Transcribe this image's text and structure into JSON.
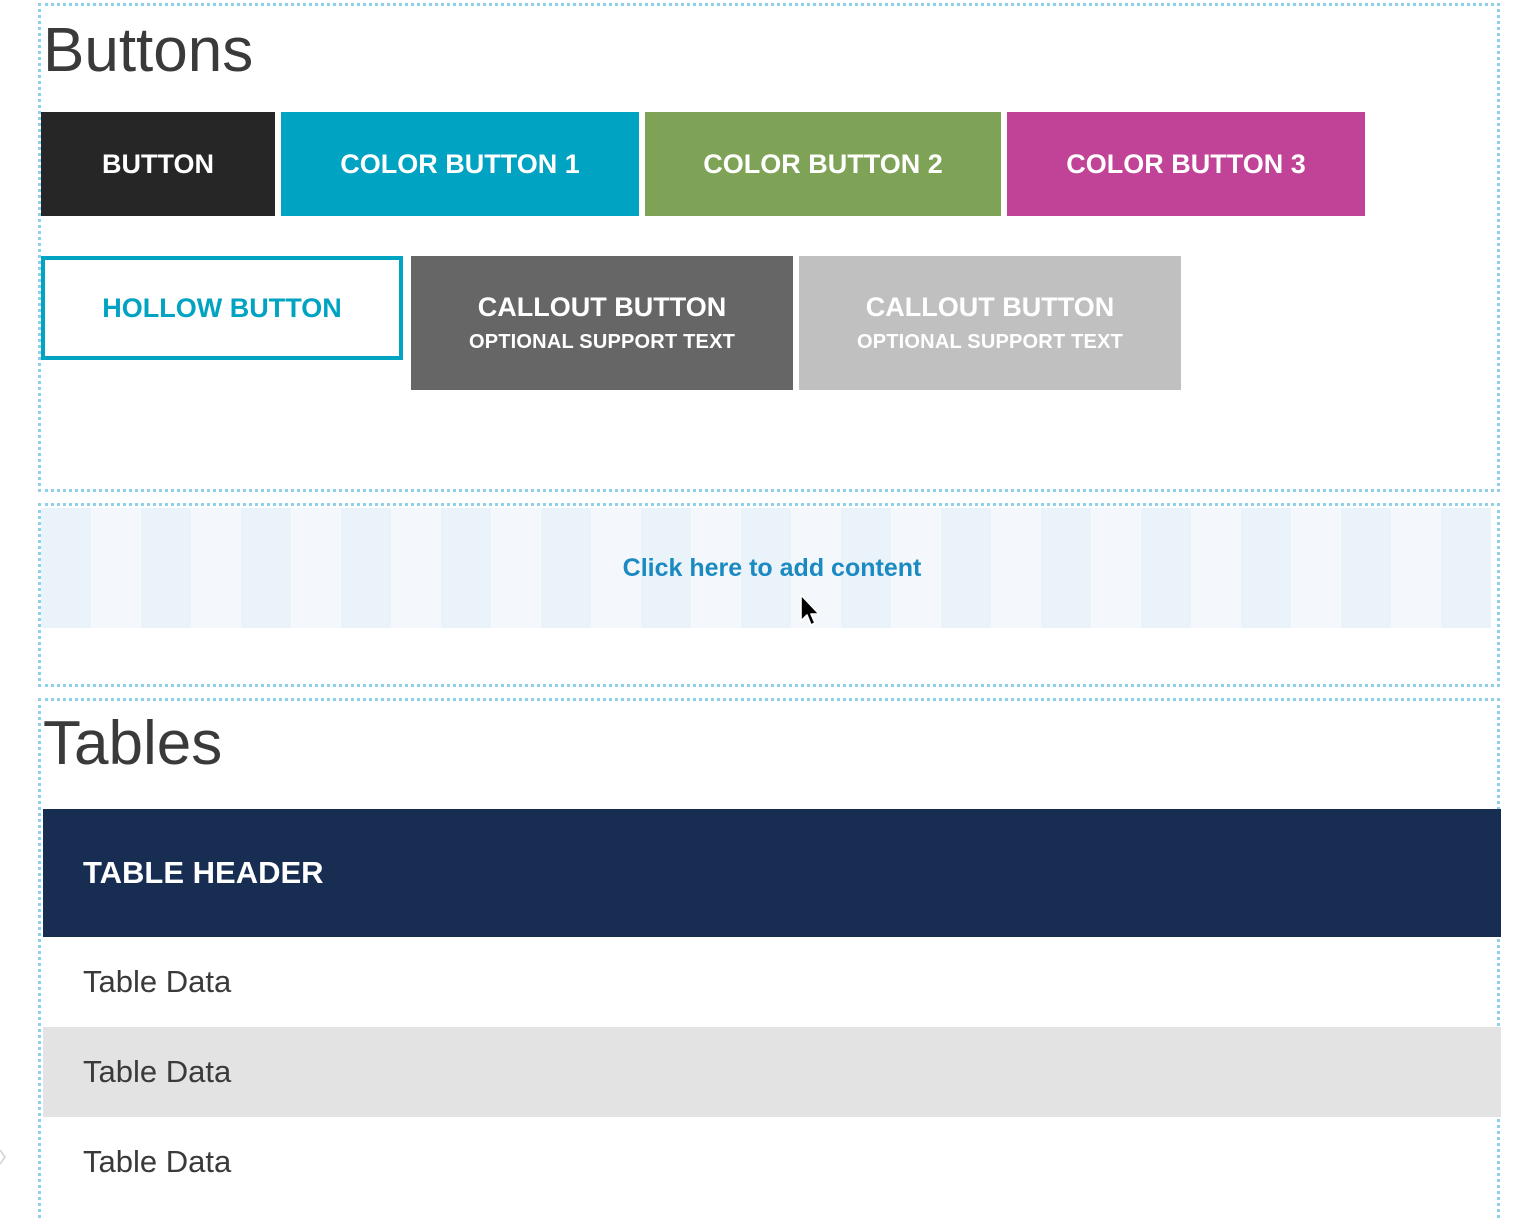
{
  "buttons_section": {
    "heading": "Buttons",
    "button": "BUTTON",
    "color_button_1": "COLOR BUTTON 1",
    "color_button_2": "COLOR BUTTON 2",
    "color_button_3": "COLOR BUTTON 3",
    "hollow_button": "HOLLOW BUTTON",
    "callout_dark": {
      "label": "CALLOUT BUTTON",
      "support": "OPTIONAL SUPPORT TEXT"
    },
    "callout_light": {
      "label": "CALLOUT BUTTON",
      "support": "OPTIONAL SUPPORT TEXT"
    }
  },
  "add_content": {
    "label": "Click here to add content"
  },
  "tables_section": {
    "heading": "Tables",
    "header": "TABLE HEADER",
    "rows": [
      "Table Data",
      "Table Data",
      "Table Data"
    ]
  },
  "colors": {
    "dark_button": "#262626",
    "color_1": "#00a3c1",
    "color_2": "#7ea356",
    "color_3": "#c04398",
    "callout_dark": "#666666",
    "callout_light": "#c0c0c0",
    "table_header": "#172d52",
    "link": "#1a8ac0"
  }
}
